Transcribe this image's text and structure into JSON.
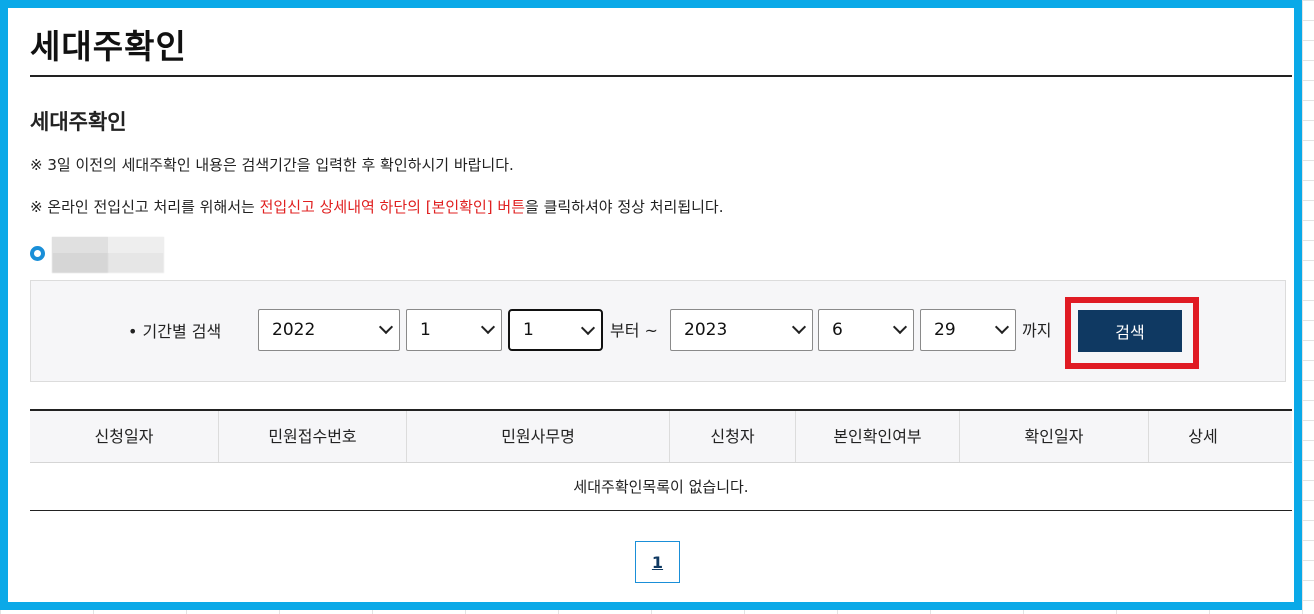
{
  "page": {
    "title": "세대주확인",
    "section_title": "세대주확인"
  },
  "notices": {
    "line1": "※ 3일 이전의 세대주확인 내용은 검색기간을 입력한 후 확인하시기 바랍니다.",
    "line2_pre": "※ 온라인 전입신고 처리를 위해서는 ",
    "line2_red": "전입신고 상세내역 하단의 [본인확인] 버튼",
    "line2_post": "을 클릭하셔야 정상 처리됩니다."
  },
  "search": {
    "label": "• 기간별 검색",
    "from_year": "2022",
    "from_month": "1",
    "from_day": "1",
    "from_word": "부터 ~",
    "to_year": "2023",
    "to_month": "6",
    "to_day": "29",
    "to_word": "까지",
    "button_label": "검색"
  },
  "table": {
    "headers": [
      "신청일자",
      "민원접수번호",
      "민원사무명",
      "신청자",
      "본인확인여부",
      "확인일자",
      "상세"
    ],
    "empty_message": "세대주확인목록이 없습니다."
  },
  "pagination": {
    "current_page": "1"
  },
  "colors": {
    "frame": "#0aa9e8",
    "button": "#0f3962",
    "highlight": "#e01b24",
    "notice_red": "#e02020"
  }
}
